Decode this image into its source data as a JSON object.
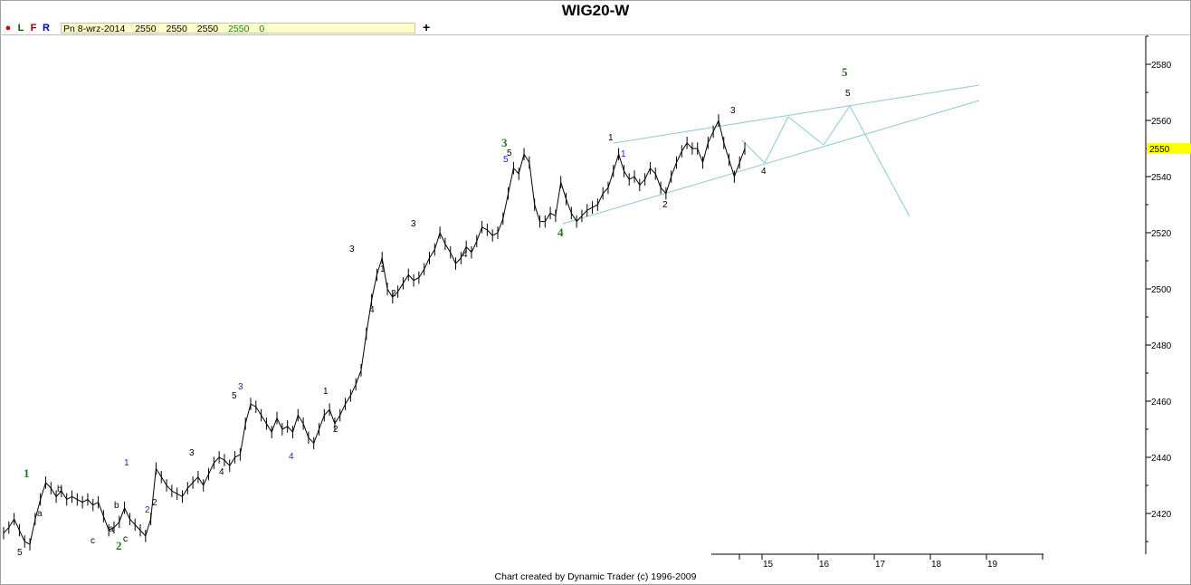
{
  "title": "WIG20-W",
  "toolbar": {
    "buttons": [
      {
        "label": "●",
        "color": "#d00000"
      },
      {
        "label": "L",
        "color": "#006400"
      },
      {
        "label": "F",
        "color": "#8b0000"
      },
      {
        "label": "R",
        "color": "#00008b"
      }
    ],
    "plus": "+"
  },
  "infobar": {
    "date": "Pn 8-wrz-2014",
    "open": "2550",
    "high": "2550",
    "low": "2550",
    "close": "2550",
    "change": "0"
  },
  "footer": "Chart created by Dynamic Trader  (c)  1996-2009",
  "chart_data": {
    "type": "line",
    "y_ticks": [
      2420,
      2440,
      2460,
      2480,
      2500,
      2520,
      2540,
      2560,
      2580
    ],
    "x_ticks": [
      "15",
      "16",
      "17",
      "18",
      "19"
    ],
    "current_price": "2550",
    "price_series": [
      2413,
      2415,
      2418,
      2414,
      2410,
      2409,
      2418,
      2425,
      2431,
      2429,
      2426,
      2428,
      2425,
      2426,
      2425,
      2424,
      2425,
      2423,
      2424,
      2419,
      2414,
      2415,
      2417,
      2422,
      2418,
      2416,
      2414,
      2412,
      2418,
      2436,
      2433,
      2430,
      2428,
      2427,
      2426,
      2429,
      2431,
      2433,
      2430,
      2434,
      2438,
      2440,
      2439,
      2437,
      2440,
      2441,
      2452,
      2459,
      2458,
      2455,
      2452,
      2449,
      2454,
      2450,
      2451,
      2449,
      2455,
      2452,
      2447,
      2445,
      2450,
      2455,
      2457,
      2452,
      2455,
      2459,
      2462,
      2466,
      2471,
      2484,
      2496,
      2505,
      2511,
      2500,
      2497,
      2499,
      2502,
      2505,
      2503,
      2504,
      2507,
      2511,
      2514,
      2520,
      2516,
      2513,
      2509,
      2511,
      2515,
      2513,
      2517,
      2522,
      2521,
      2519,
      2520,
      2525,
      2534,
      2543,
      2541,
      2548,
      2545,
      2530,
      2524,
      2524,
      2527,
      2526,
      2538,
      2532,
      2527,
      2524,
      2526,
      2528,
      2529,
      2530,
      2534,
      2536,
      2542,
      2548,
      2542,
      2539,
      2540,
      2537,
      2539,
      2543,
      2541,
      2536,
      2534,
      2540,
      2545,
      2549,
      2552,
      2550,
      2550,
      2545,
      2552,
      2556,
      2560,
      2552,
      2546,
      2540,
      2545,
      2550
    ],
    "wave_labels": [
      {
        "text": "1",
        "color": "#1e7b1e",
        "degree": "primary"
      },
      {
        "text": "2",
        "color": "#1e7b1e",
        "degree": "primary"
      },
      {
        "text": "3",
        "color": "#1e7b1e",
        "degree": "primary"
      },
      {
        "text": "4",
        "color": "#1e7b1e",
        "degree": "primary"
      },
      {
        "text": "5",
        "color": "#1e7b1e",
        "degree": "primary"
      },
      {
        "text": "1",
        "color": "#2020c0",
        "degree": "intermediate"
      },
      {
        "text": "2",
        "color": "#2020c0",
        "degree": "intermediate"
      },
      {
        "text": "3",
        "color": "#2020c0",
        "degree": "intermediate"
      },
      {
        "text": "4",
        "color": "#2020c0",
        "degree": "intermediate"
      },
      {
        "text": "5",
        "color": "#2020c0",
        "degree": "intermediate"
      },
      {
        "text": "1",
        "color": "#000000",
        "degree": "minor"
      },
      {
        "text": "2",
        "color": "#000000",
        "degree": "minor"
      },
      {
        "text": "3",
        "color": "#000000",
        "degree": "minor"
      },
      {
        "text": "4",
        "color": "#000000",
        "degree": "minor"
      },
      {
        "text": "5",
        "color": "#000000",
        "degree": "minor"
      },
      {
        "text": "a",
        "color": "#000000",
        "degree": "minor"
      },
      {
        "text": "b",
        "color": "#000000",
        "degree": "minor"
      },
      {
        "text": "c",
        "color": "#000000",
        "degree": "minor"
      }
    ],
    "projection_color": "#8ec8d4",
    "line_color": "#000000",
    "highlight_color": "#ffff00"
  }
}
